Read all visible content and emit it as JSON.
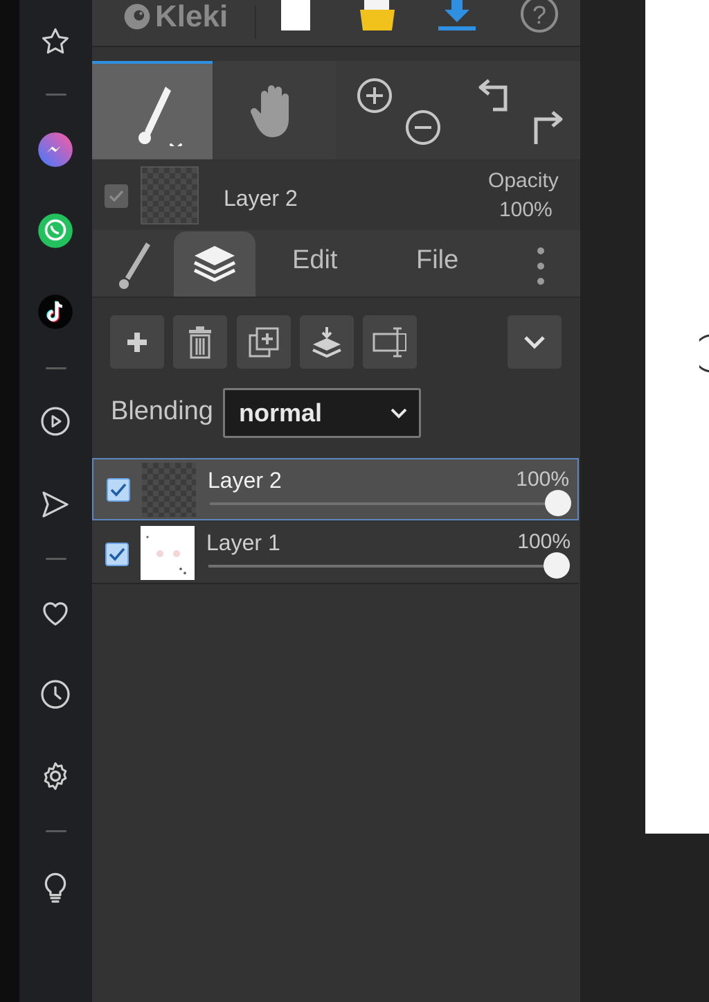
{
  "browser_sidebar": {
    "icons": [
      "star-icon",
      "messenger-icon",
      "whatsapp-icon",
      "tiktok-icon",
      "play-icon",
      "send-icon",
      "heart-icon",
      "clock-icon",
      "gear-icon",
      "lightbulb-icon"
    ]
  },
  "app": {
    "logo_text": "Kleki",
    "top_actions": [
      "new-image-icon",
      "open-folder-icon",
      "download-icon",
      "help-icon"
    ]
  },
  "tools": {
    "active": "brush",
    "items": [
      "brush-tool-icon",
      "hand-tool-icon",
      "zoom-in-icon",
      "zoom-out-icon",
      "undo-icon",
      "redo-icon"
    ]
  },
  "current_layer": {
    "name": "Layer 2",
    "opacity_label": "Opacity",
    "opacity_value": "100%",
    "visible": true
  },
  "tabs": {
    "items": [
      {
        "id": "brush",
        "label": ""
      },
      {
        "id": "layers",
        "label": ""
      },
      {
        "id": "edit",
        "label": "Edit"
      },
      {
        "id": "file",
        "label": "File"
      }
    ],
    "active": "layers"
  },
  "layer_actions": [
    "add-layer-icon",
    "delete-layer-icon",
    "duplicate-layer-icon",
    "merge-down-icon",
    "rename-layer-icon",
    "more-dropdown-icon"
  ],
  "blending": {
    "label": "Blending",
    "value": "normal"
  },
  "layers": [
    {
      "name": "Layer 2",
      "opacity": "100%",
      "visible": true,
      "selected": true,
      "opacity_fraction": 1.0
    },
    {
      "name": "Layer 1",
      "opacity": "100%",
      "visible": true,
      "selected": false,
      "opacity_fraction": 1.0
    }
  ],
  "colors": {
    "accent_blue": "#2f8fe0",
    "folder_yellow": "#f1c21b",
    "messenger_gradient_start": "#3f7bff",
    "messenger_gradient_end": "#ff5aa0",
    "whatsapp_green": "#22c15e"
  }
}
